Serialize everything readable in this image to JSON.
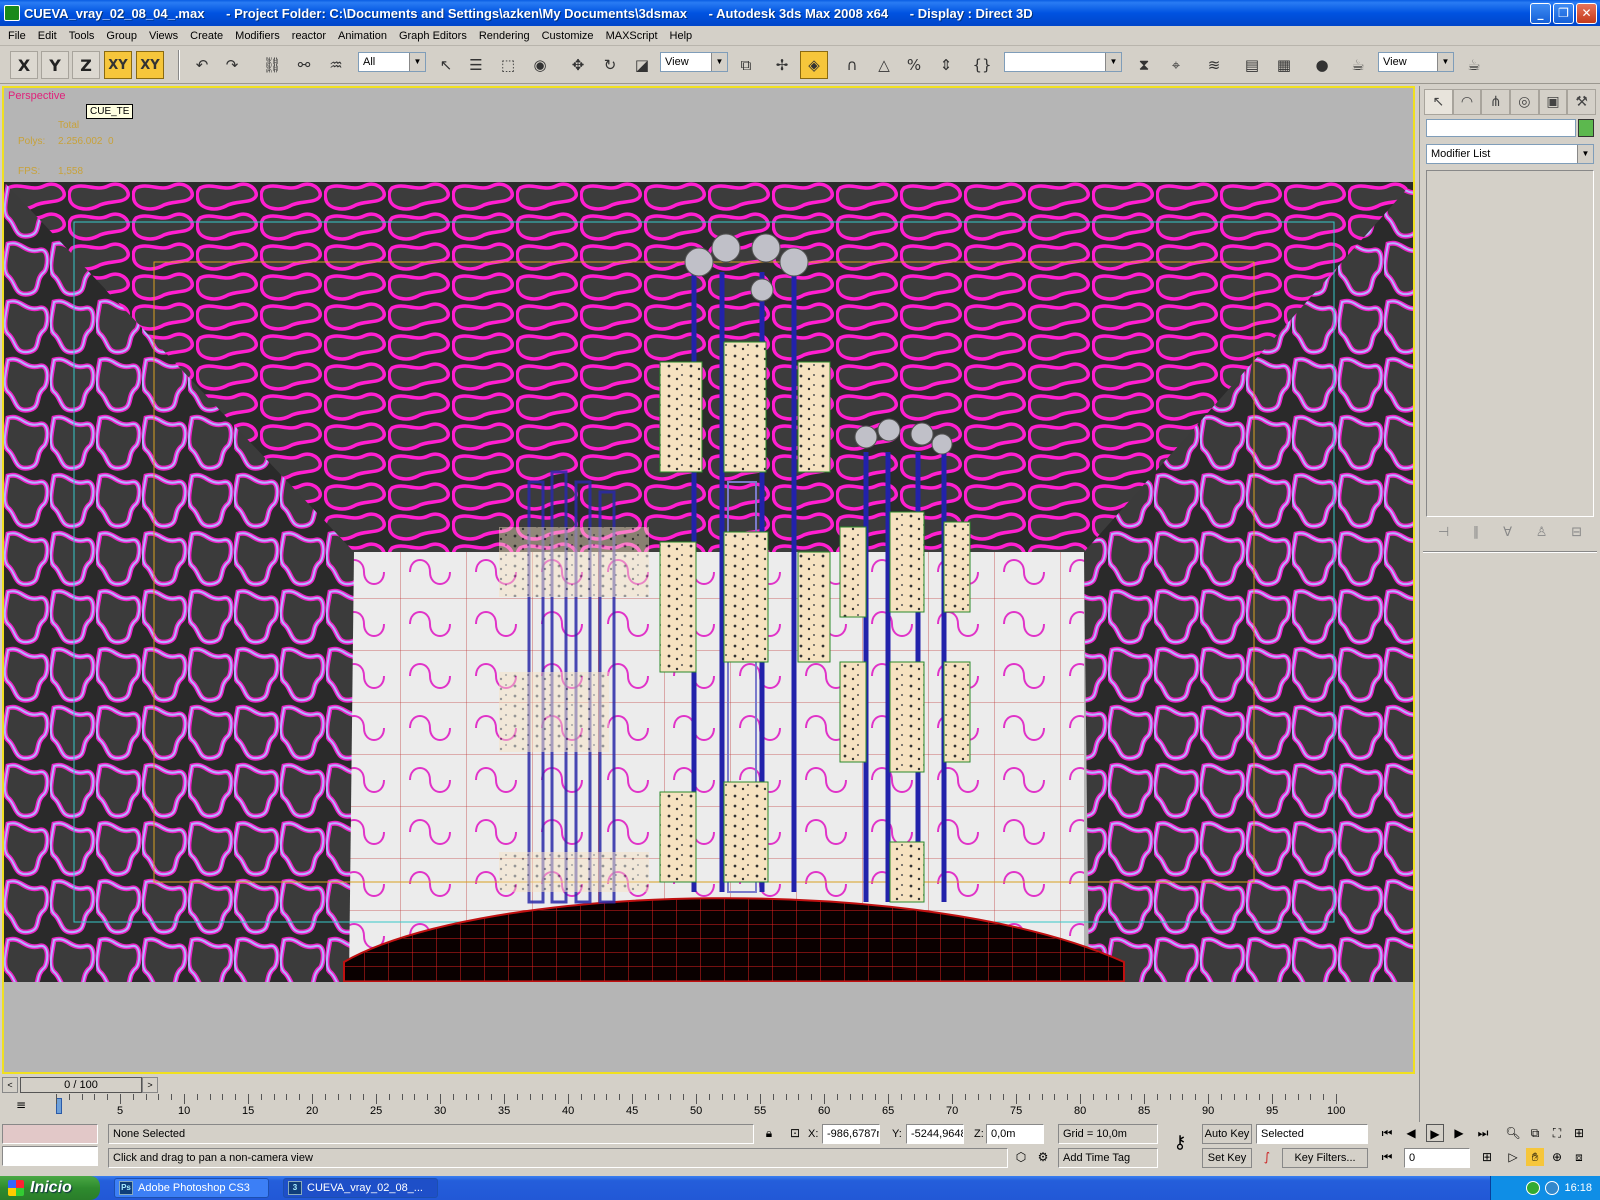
{
  "window": {
    "title": "CUEVA_vray_02_08_04_.max      - Project Folder: C:\\Documents and Settings\\azken\\My Documents\\3dsmax      - Autodesk 3ds Max 2008 x64      - Display : Direct 3D",
    "minimize": "_",
    "maximize": "❐",
    "close": "✕"
  },
  "menu": [
    "File",
    "Edit",
    "Tools",
    "Group",
    "Views",
    "Create",
    "Modifiers",
    "reactor",
    "Animation",
    "Graph Editors",
    "Rendering",
    "Customize",
    "MAXScript",
    "Help"
  ],
  "toolbar": {
    "axis": {
      "x": "X",
      "y": "Y",
      "z": "Z",
      "xy": "XY",
      "xy2": "XY"
    },
    "selection_filter": "All",
    "ref_coord": "View",
    "named_selection": "",
    "render_view": "View"
  },
  "viewport": {
    "label": "Perspective",
    "tooltip": "CUE_TE",
    "total_label": "Total",
    "polys_label": "Polys:",
    "polys_value": "2.256.002  0",
    "fps_label": "FPS:",
    "fps_value": "1,558"
  },
  "command_panel": {
    "name_field": "",
    "object_color": "#5cb84e",
    "modifier_list": "Modifier List"
  },
  "time": {
    "slider": "0 / 100",
    "prev": "<",
    "next": ">",
    "ticks": [
      "5",
      "10",
      "15",
      "20",
      "25",
      "30",
      "35",
      "40",
      "45",
      "50",
      "55",
      "60",
      "65",
      "70",
      "75",
      "80",
      "85",
      "90",
      "95",
      "100"
    ]
  },
  "status": {
    "selection": "None Selected",
    "prompt": "Click and drag to pan a non-camera view",
    "x_label": "X:",
    "x_value": "-986,6787r",
    "y_label": "Y:",
    "y_value": "-5244,9648",
    "z_label": "Z:",
    "z_value": "0,0m",
    "grid": "Grid = 10,0m",
    "add_time_tag": "Add Time Tag",
    "auto_key": "Auto Key",
    "set_key": "Set Key",
    "key_mode": "Selected",
    "key_filters": "Key Filters...",
    "frame": "0"
  },
  "taskbar": {
    "start": "Inicio",
    "tasks": [
      {
        "icon": "Ps",
        "label": "Adobe Photoshop CS3"
      },
      {
        "icon": "3",
        "label": "CUEVA_vray_02_08_..."
      }
    ],
    "clock": "16:18"
  }
}
